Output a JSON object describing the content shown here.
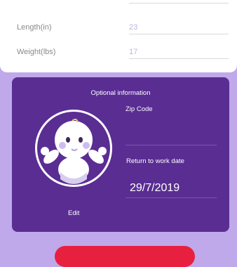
{
  "measurements": {
    "length_label": "Length(in)",
    "length_value": "23",
    "weight_label": "Weight(lbs)",
    "weight_value": "17"
  },
  "optional_info": {
    "title": "Optional information",
    "zip_label": "Zip Code",
    "zip_value": "",
    "return_label": "Return to work date",
    "return_value": "29/7/2019",
    "edit_label": "Edit",
    "avatar_icon": "baby-icon"
  },
  "colors": {
    "page_background": "#bfa9ea",
    "card_purple": "#5a2d93",
    "accent_red": "#e8203f"
  }
}
